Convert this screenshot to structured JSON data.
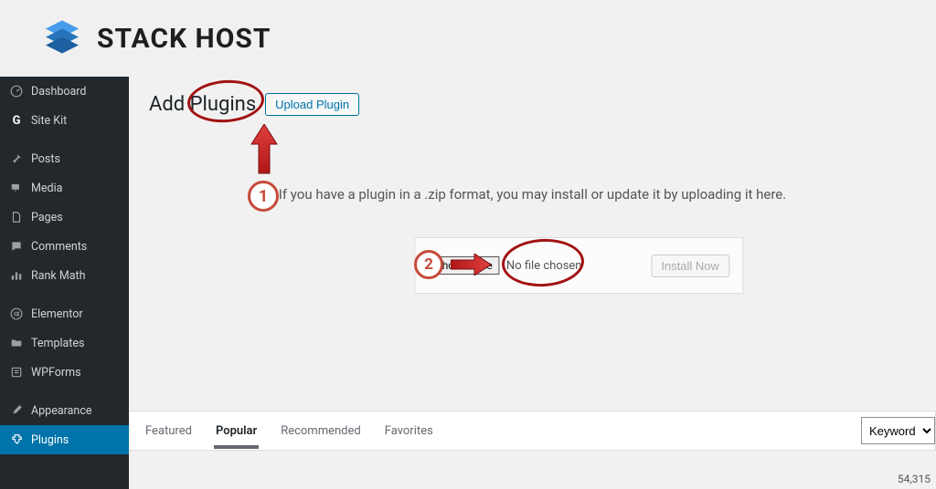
{
  "brand": {
    "name": "STACK HOST"
  },
  "sidebar": {
    "items": [
      {
        "label": "Dashboard"
      },
      {
        "label": "Site Kit"
      },
      {
        "label": "Posts"
      },
      {
        "label": "Media"
      },
      {
        "label": "Pages"
      },
      {
        "label": "Comments"
      },
      {
        "label": "Rank Math"
      },
      {
        "label": "Elementor"
      },
      {
        "label": "Templates"
      },
      {
        "label": "WPForms"
      },
      {
        "label": "Appearance"
      },
      {
        "label": "Plugins"
      }
    ]
  },
  "page": {
    "title": "Add Plugins",
    "upload_button": "Upload Plugin",
    "instruction": "If you have a plugin in a .zip format, you may install or update it by uploading it here.",
    "choose_file": "Choose File",
    "no_file": "No file chosen",
    "install_now": "Install Now"
  },
  "annotations": {
    "step1": "1",
    "step2": "2"
  },
  "tabs": {
    "items": [
      {
        "label": "Featured"
      },
      {
        "label": "Popular"
      },
      {
        "label": "Recommended"
      },
      {
        "label": "Favorites"
      }
    ],
    "filter_selected": "Keyword"
  },
  "result_count": "54,315"
}
